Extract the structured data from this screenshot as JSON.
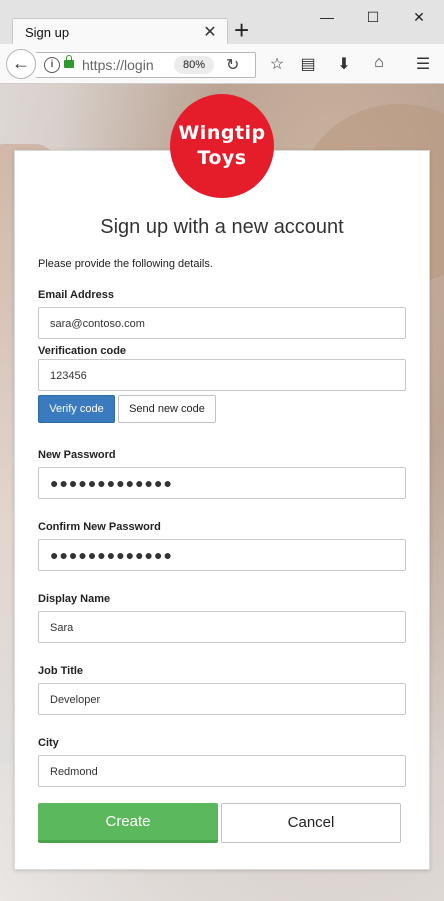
{
  "browser": {
    "tab_title": "Sign up",
    "url": "https://login",
    "zoom": "80%"
  },
  "logo": {
    "line1": "Wingtip",
    "line2": "Toys",
    "color": "#e51d2a"
  },
  "form": {
    "heading": "Sign up with a new account",
    "intro": "Please provide the following details.",
    "email": {
      "label": "Email Address",
      "value": "sara@contoso.com"
    },
    "verification": {
      "label": "Verification code",
      "value": "123456",
      "verify_label": "Verify code",
      "send_label": "Send new code"
    },
    "new_password": {
      "label": "New Password",
      "value": "●●●●●●●●●●●●●"
    },
    "confirm_password": {
      "label": "Confirm New Password",
      "value": "●●●●●●●●●●●●●"
    },
    "display_name": {
      "label": "Display Name",
      "value": "Sara"
    },
    "job_title": {
      "label": "Job Title",
      "value": "Developer"
    },
    "city": {
      "label": "City",
      "value": "Redmond"
    },
    "create_label": "Create",
    "cancel_label": "Cancel"
  },
  "colors": {
    "primary": "#3a7bbf",
    "success": "#5cb85c"
  }
}
